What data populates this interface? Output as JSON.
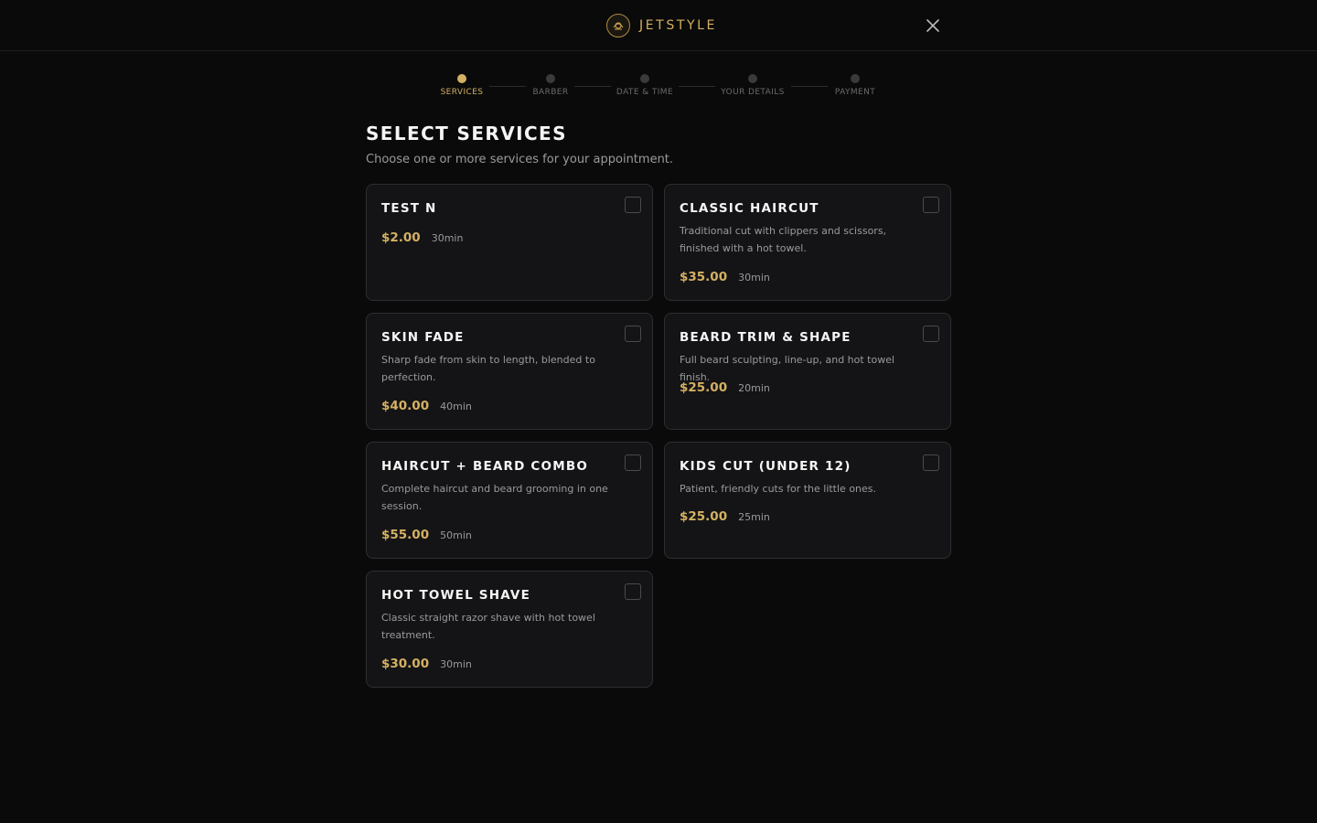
{
  "brand": {
    "name": "JETSTYLE",
    "accent_color": "#d4b062"
  },
  "close_icon": "close-icon",
  "steps": [
    {
      "label": "SERVICES",
      "active": true
    },
    {
      "label": "BARBER",
      "active": false
    },
    {
      "label": "DATE & TIME",
      "active": false
    },
    {
      "label": "YOUR DETAILS",
      "active": false
    },
    {
      "label": "PAYMENT",
      "active": false
    }
  ],
  "page": {
    "title": "SELECT SERVICES",
    "subtitle": "Choose one or more services for your appointment."
  },
  "services": [
    {
      "name": "TEST N",
      "description": "",
      "price": "$2.00",
      "duration": "30min",
      "selected": false
    },
    {
      "name": "CLASSIC HAIRCUT",
      "description": "Traditional cut with clippers and scissors, finished with a hot towel.",
      "price": "$35.00",
      "duration": "30min",
      "selected": false
    },
    {
      "name": "SKIN FADE",
      "description": "Sharp fade from skin to length, blended to perfection.",
      "price": "$40.00",
      "duration": "40min",
      "selected": false
    },
    {
      "name": "BEARD TRIM & SHAPE",
      "description": "Full beard sculpting, line-up, and hot towel finish.",
      "price": "$25.00",
      "duration": "20min",
      "selected": false
    },
    {
      "name": "HAIRCUT + BEARD COMBO",
      "description": "Complete haircut and beard grooming in one session.",
      "price": "$55.00",
      "duration": "50min",
      "selected": false
    },
    {
      "name": "KIDS CUT (UNDER 12)",
      "description": "Patient, friendly cuts for the little ones.",
      "price": "$25.00",
      "duration": "25min",
      "selected": false
    },
    {
      "name": "HOT TOWEL SHAVE",
      "description": "Classic straight razor shave with hot towel treatment.",
      "price": "$30.00",
      "duration": "30min",
      "selected": false
    }
  ]
}
